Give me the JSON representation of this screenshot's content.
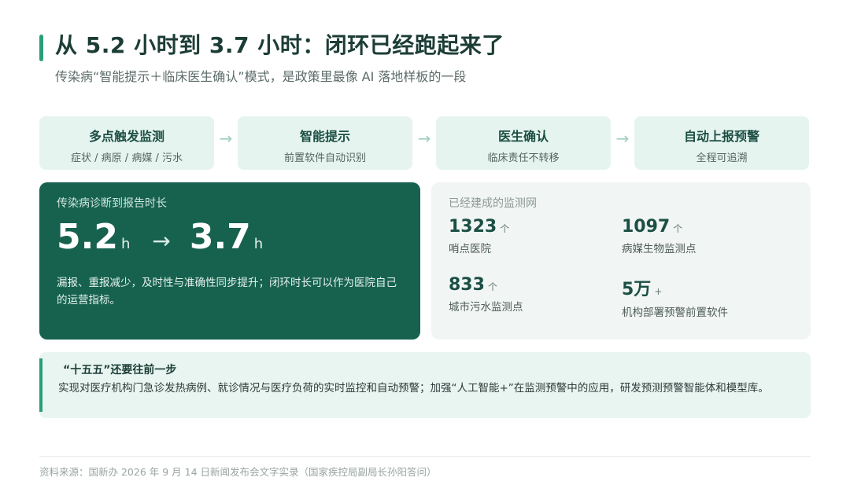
{
  "header": {
    "title": "从 5.2 小时到 3.7 小时：闭环已经跑起来了",
    "subtitle": "传染病“智能提示＋临床医生确认”模式，是政策里最像 AI 落地样板的一段"
  },
  "flow": {
    "steps": [
      {
        "title": "多点触发监测",
        "desc": "症状 / 病原 / 病媒 / 污水"
      },
      {
        "title": "智能提示",
        "desc": "前置软件自动识别"
      },
      {
        "title": "医生确认",
        "desc": "临床责任不转移"
      },
      {
        "title": "自动上报预警",
        "desc": "全程可追溯"
      }
    ],
    "arrow_glyph": "→"
  },
  "metric": {
    "label": "传染病诊断到报告时长",
    "before": "5.2",
    "after": "3.7",
    "unit": "h",
    "arrow_glyph": "→",
    "note": "漏报、重报减少，及时性与准确性同步提升；闭环时长可以作为医院自己的运营指标。"
  },
  "network": {
    "title": "已经建成的监测网",
    "stats": [
      {
        "value": "1323",
        "unit": "个",
        "label": "哨点医院"
      },
      {
        "value": "1097",
        "unit": "个",
        "label": "病媒生物监测点"
      },
      {
        "value": "833",
        "unit": "个",
        "label": "城市污水监测点"
      },
      {
        "value": "5万",
        "unit": "+",
        "label": "机构部署预警前置软件"
      }
    ]
  },
  "callout": {
    "title": "“十五五”还要往前一步",
    "text": "实现对医疗机构门急诊发热病例、就诊情况与医疗负荷的实时监控和自动预警；加强“人工智能+”在监测预警中的应用，研发预测预警智能体和模型库。"
  },
  "footer": {
    "source": "资料来源：国新办 2026 年 9 月 14 日新闻发布会文字实录（国家疾控局副局长孙阳答问）"
  },
  "colors": {
    "accent": "#2a9d7a",
    "dark_green": "#17624f",
    "light_green": "#e6f4ef"
  }
}
